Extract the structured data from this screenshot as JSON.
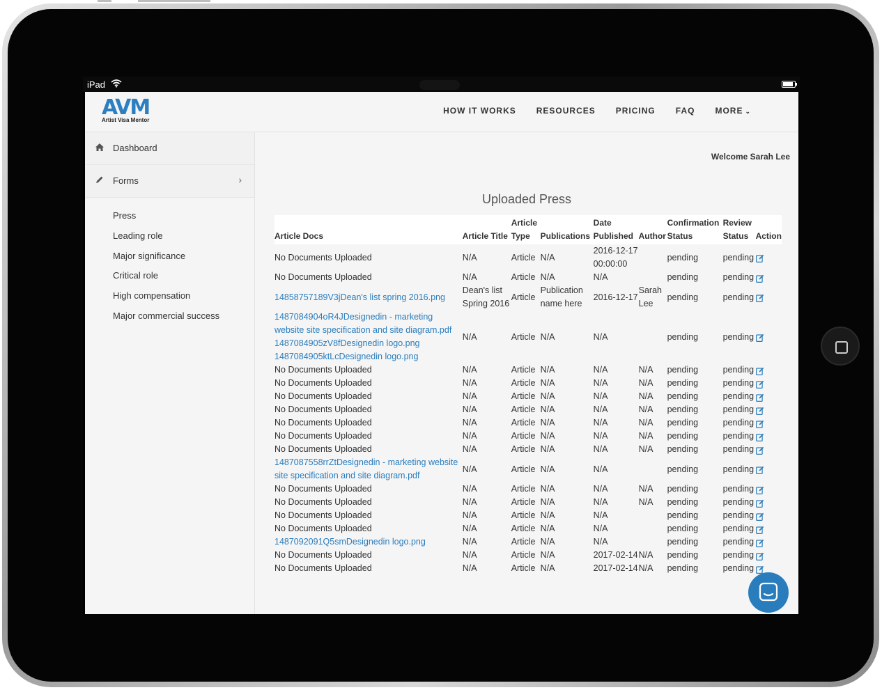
{
  "status_bar": {
    "carrier": "iPad",
    "battery_level": 0.9
  },
  "brand": {
    "logo_mark": "AVM",
    "logo_text": "Artist Visa Mentor",
    "accent": "#2d7fc1"
  },
  "nav": {
    "items": [
      "HOW IT WORKS",
      "RESOURCES",
      "PRICING",
      "FAQ",
      "MORE"
    ]
  },
  "sidebar": {
    "dashboard": "Dashboard",
    "forms": "Forms",
    "sub_items": [
      "Press",
      "Leading role",
      "Major significance",
      "Critical role",
      "High compensation",
      "Major commercial success"
    ]
  },
  "main": {
    "welcome": "Welcome Sarah Lee",
    "title": "Uploaded Press"
  },
  "table": {
    "headers": [
      "Article Docs",
      "Article Title",
      "Article Type",
      "Publications",
      "Date Published",
      "Author",
      "Confirmation Status",
      "Review Status",
      "Action"
    ],
    "rows": [
      {
        "docs": [
          "No Documents Uploaded"
        ],
        "doc_link": false,
        "title": "N/A",
        "type": "Article",
        "pub": "N/A",
        "date": "2016-12-17 00:00:00",
        "author": "",
        "conf": "pending",
        "review": "pending"
      },
      {
        "docs": [
          "No Documents Uploaded"
        ],
        "doc_link": false,
        "title": "N/A",
        "type": "Article",
        "pub": "N/A",
        "date": "N/A",
        "author": "",
        "conf": "pending",
        "review": "pending"
      },
      {
        "docs": [
          "14858757189V3jDean's list spring 2016.png"
        ],
        "doc_link": true,
        "title": "Dean's list Spring 2016",
        "type": "Article",
        "pub": "Publication name here",
        "date": "2016-12-17",
        "author": "Sarah Lee",
        "conf": "pending",
        "review": "pending"
      },
      {
        "docs": [
          "1487084904oR4JDesignedin - marketing website site specification and site diagram.pdf",
          "1487084905zV8fDesignedin logo.png",
          "1487084905ktLcDesignedin logo.png"
        ],
        "doc_link": true,
        "title": "N/A",
        "type": "Article",
        "pub": "N/A",
        "date": "N/A",
        "author": "",
        "conf": "pending",
        "review": "pending"
      },
      {
        "docs": [
          "No Documents Uploaded"
        ],
        "doc_link": false,
        "title": "N/A",
        "type": "Article",
        "pub": "N/A",
        "date": "N/A",
        "author": "N/A",
        "conf": "pending",
        "review": "pending"
      },
      {
        "docs": [
          "No Documents Uploaded"
        ],
        "doc_link": false,
        "title": "N/A",
        "type": "Article",
        "pub": "N/A",
        "date": "N/A",
        "author": "N/A",
        "conf": "pending",
        "review": "pending"
      },
      {
        "docs": [
          "No Documents Uploaded"
        ],
        "doc_link": false,
        "title": "N/A",
        "type": "Article",
        "pub": "N/A",
        "date": "N/A",
        "author": "N/A",
        "conf": "pending",
        "review": "pending"
      },
      {
        "docs": [
          "No Documents Uploaded"
        ],
        "doc_link": false,
        "title": "N/A",
        "type": "Article",
        "pub": "N/A",
        "date": "N/A",
        "author": "N/A",
        "conf": "pending",
        "review": "pending"
      },
      {
        "docs": [
          "No Documents Uploaded"
        ],
        "doc_link": false,
        "title": "N/A",
        "type": "Article",
        "pub": "N/A",
        "date": "N/A",
        "author": "N/A",
        "conf": "pending",
        "review": "pending"
      },
      {
        "docs": [
          "No Documents Uploaded"
        ],
        "doc_link": false,
        "title": "N/A",
        "type": "Article",
        "pub": "N/A",
        "date": "N/A",
        "author": "N/A",
        "conf": "pending",
        "review": "pending"
      },
      {
        "docs": [
          "No Documents Uploaded"
        ],
        "doc_link": false,
        "title": "N/A",
        "type": "Article",
        "pub": "N/A",
        "date": "N/A",
        "author": "N/A",
        "conf": "pending",
        "review": "pending"
      },
      {
        "docs": [
          "1487087558rrZtDesignedin - marketing website site specification and site diagram.pdf"
        ],
        "doc_link": true,
        "title": "N/A",
        "type": "Article",
        "pub": "N/A",
        "date": "N/A",
        "author": "",
        "conf": "pending",
        "review": "pending"
      },
      {
        "docs": [
          "No Documents Uploaded"
        ],
        "doc_link": false,
        "title": "N/A",
        "type": "Article",
        "pub": "N/A",
        "date": "N/A",
        "author": "N/A",
        "conf": "pending",
        "review": "pending"
      },
      {
        "docs": [
          "No Documents Uploaded"
        ],
        "doc_link": false,
        "title": "N/A",
        "type": "Article",
        "pub": "N/A",
        "date": "N/A",
        "author": "N/A",
        "conf": "pending",
        "review": "pending"
      },
      {
        "docs": [
          "No Documents Uploaded"
        ],
        "doc_link": false,
        "title": "N/A",
        "type": "Article",
        "pub": "N/A",
        "date": "N/A",
        "author": "",
        "conf": "pending",
        "review": "pending"
      },
      {
        "docs": [
          "No Documents Uploaded"
        ],
        "doc_link": false,
        "title": "N/A",
        "type": "Article",
        "pub": "N/A",
        "date": "N/A",
        "author": "",
        "conf": "pending",
        "review": "pending"
      },
      {
        "docs": [
          "1487092091Q5smDesignedin logo.png"
        ],
        "doc_link": true,
        "title": "N/A",
        "type": "Article",
        "pub": "N/A",
        "date": "N/A",
        "author": "",
        "conf": "pending",
        "review": "pending"
      },
      {
        "docs": [
          "No Documents Uploaded"
        ],
        "doc_link": false,
        "title": "N/A",
        "type": "Article",
        "pub": "N/A",
        "date": "2017-02-14",
        "author": "N/A",
        "conf": "pending",
        "review": "pending"
      },
      {
        "docs": [
          "No Documents Uploaded"
        ],
        "doc_link": false,
        "title": "N/A",
        "type": "Article",
        "pub": "N/A",
        "date": "2017-02-14",
        "author": "N/A",
        "conf": "pending",
        "review": "pending"
      }
    ]
  },
  "icons": {
    "edit": "edit-icon",
    "chat": "chat-icon",
    "home": "home-icon",
    "pencil": "pencil-icon",
    "wifi": "wifi-icon",
    "chevron": "chevron-right-icon"
  },
  "colors": {
    "link": "#2a7dbd",
    "nav_bg": "#f5f5f5"
  }
}
